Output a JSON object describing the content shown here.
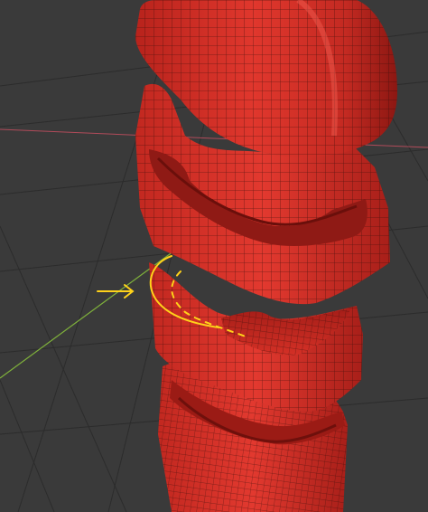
{
  "viewport": {
    "background_color": "#3a3a3a",
    "grid_color": "#2c2c2c",
    "y_axis_color": "#7fb13b",
    "x_axis_color": "#b14b5a",
    "mesh_color": "#d8322a",
    "mesh_dark_color": "#8f1a15",
    "wire_color": "#2a0b08",
    "annotation_color": "#ffd21a",
    "objects": [
      {
        "name": "upper-body-mesh"
      },
      {
        "name": "ring-1-mesh"
      },
      {
        "name": "ring-2-mesh"
      },
      {
        "name": "ring-3-mesh"
      }
    ],
    "annotation": {
      "arrow_icon": "right-arrow-icon",
      "marks": [
        "curve-mark",
        "dashed-curve-mark"
      ]
    }
  }
}
